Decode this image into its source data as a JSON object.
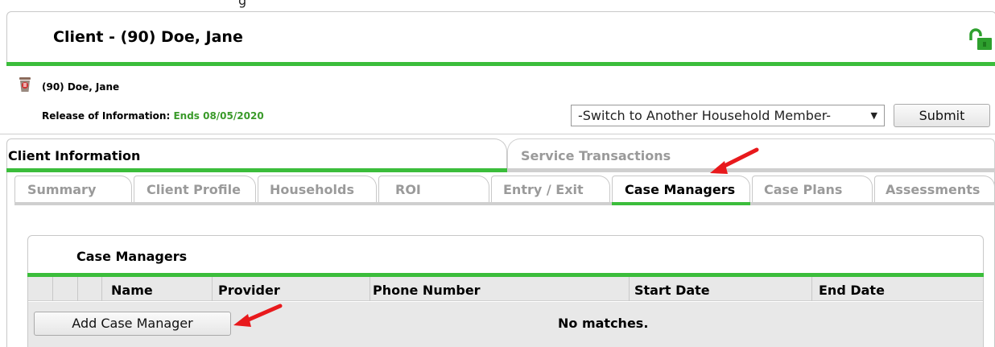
{
  "header": {
    "top_cut_text": "g",
    "title": "Client - (90) Doe, Jane"
  },
  "client": {
    "name": "(90) Doe, Jane",
    "roi_label": "Release of Information:",
    "roi_value": "Ends 08/05/2020"
  },
  "household": {
    "select_value": "-Switch to Another Household Member-",
    "submit_label": "Submit"
  },
  "main_tabs": [
    {
      "label": "Client Information",
      "active": true
    },
    {
      "label": "Service Transactions",
      "active": false
    }
  ],
  "sub_tabs": [
    {
      "label": "Summary",
      "active": false
    },
    {
      "label": "Client Profile",
      "active": false
    },
    {
      "label": "Households",
      "active": false
    },
    {
      "label": "ROI",
      "active": false
    },
    {
      "label": "Entry / Exit",
      "active": false
    },
    {
      "label": "Case Managers",
      "active": true
    },
    {
      "label": "Case Plans",
      "active": false
    },
    {
      "label": "Assessments",
      "active": false
    }
  ],
  "case_managers": {
    "title": "Case Managers",
    "columns": [
      "Name",
      "Provider",
      "Phone Number",
      "Start Date",
      "End Date"
    ],
    "add_button_label": "Add Case Manager",
    "empty_message": "No matches."
  },
  "colors": {
    "accent_green": "#3bbd3b",
    "roi_green": "#3a9a2a",
    "arrow_red": "#e8191c"
  },
  "icons": [
    "lock-open-icon",
    "client-trash-icon",
    "dropdown-arrow-icon",
    "red-arrow-icon"
  ]
}
